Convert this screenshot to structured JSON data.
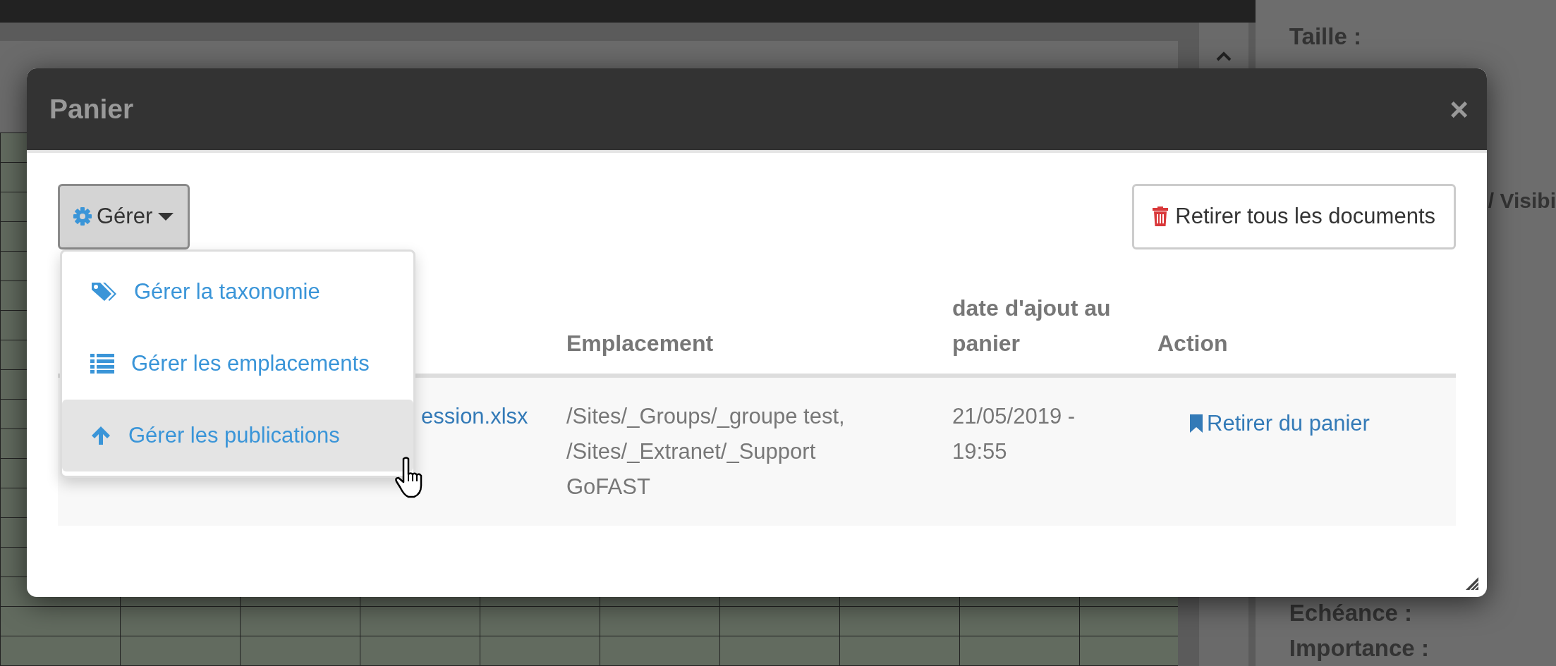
{
  "side_panel": {
    "top_labels": [
      "Taille :"
    ],
    "middle_labels": [
      "/ Visibi"
    ],
    "bottom_labels": [
      "Echéance :",
      "Importance :"
    ]
  },
  "modal": {
    "title": "Panier",
    "close": "×",
    "manage_button": {
      "label": "Gérer",
      "expanded": true
    },
    "remove_all_button": {
      "label": "Retirer tous les documents"
    },
    "menu": [
      {
        "kind": "tags",
        "label": "Gérer la taxonomie",
        "selected": false
      },
      {
        "kind": "list",
        "label": "Gérer les emplacements",
        "selected": false
      },
      {
        "kind": "upload",
        "label": "Gérer les publications",
        "selected": true
      }
    ],
    "table": {
      "columns": [
        "Emplacement",
        "date d'ajout au panier",
        "Action"
      ],
      "rows": [
        {
          "name": "ession.xlsx",
          "location": [
            "/Sites/_Groups/_groupe test,",
            "/Sites/_Extranet/_Support",
            "GoFAST"
          ],
          "date": [
            "21/05/2019 -",
            "19:55"
          ],
          "action": "Retirer du panier"
        }
      ]
    }
  }
}
